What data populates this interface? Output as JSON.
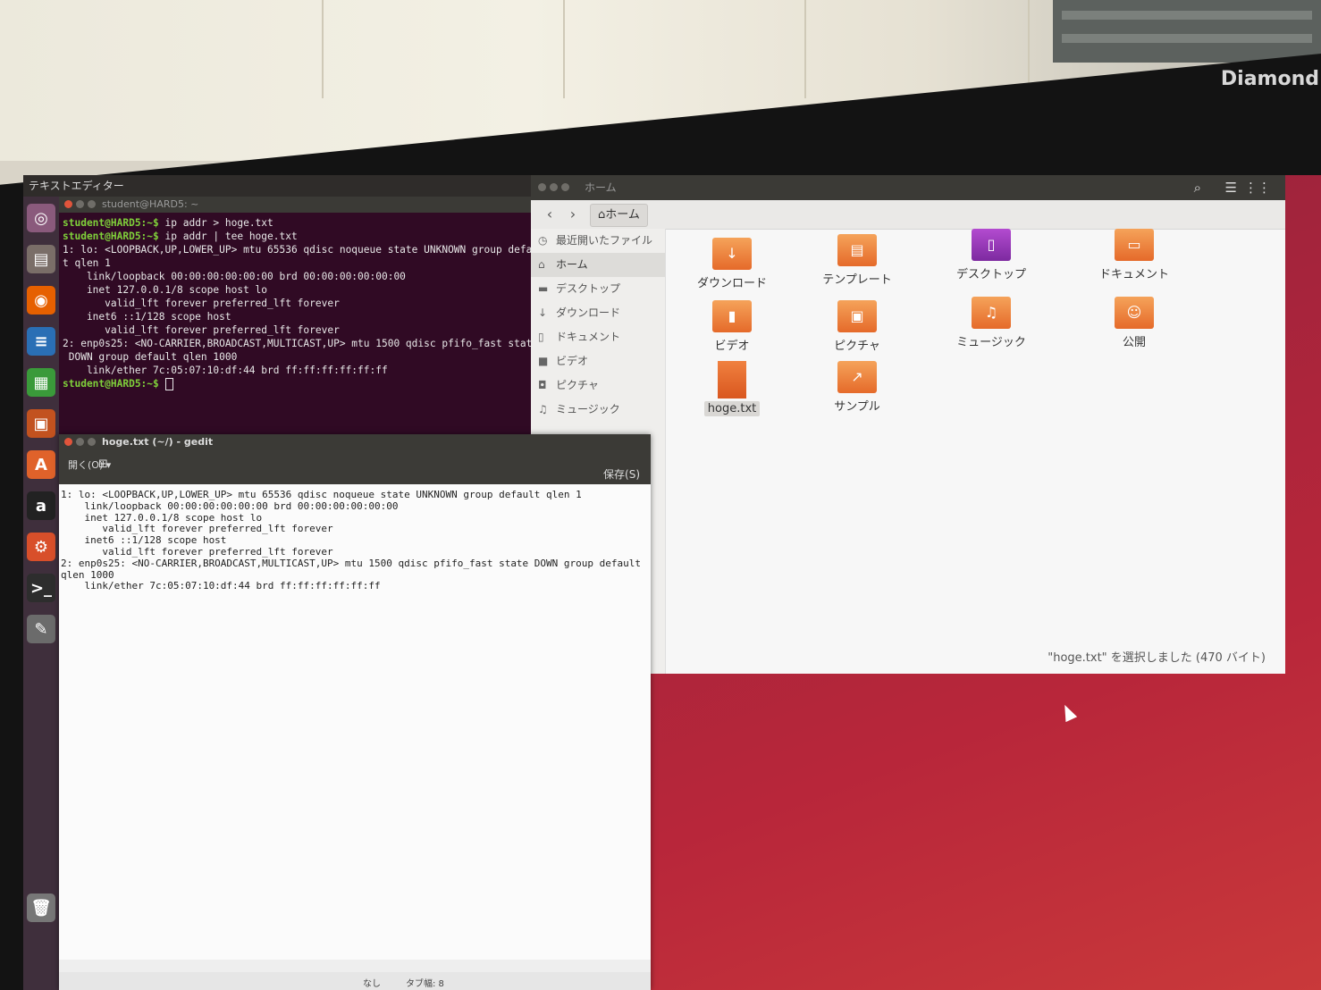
{
  "brand": "Diamond",
  "topbar": {
    "app_title": "テキストエディター"
  },
  "launcher": {
    "items": [
      {
        "name": "ubuntu-home-icon",
        "glyph": "◎"
      },
      {
        "name": "files-icon",
        "glyph": "▤"
      },
      {
        "name": "firefox-icon",
        "glyph": "◉"
      },
      {
        "name": "writer-icon",
        "glyph": "≡"
      },
      {
        "name": "calc-icon",
        "glyph": "▦"
      },
      {
        "name": "impress-icon",
        "glyph": "▣"
      },
      {
        "name": "software-center-icon",
        "glyph": "A"
      },
      {
        "name": "amazon-icon",
        "glyph": "a"
      },
      {
        "name": "settings-icon",
        "glyph": "⚙"
      },
      {
        "name": "terminal-icon",
        "glyph": ">_"
      },
      {
        "name": "text-editor-icon",
        "glyph": "✎"
      },
      {
        "name": "trash-icon",
        "glyph": "🗑"
      }
    ]
  },
  "terminal": {
    "title": "student@HARD5: ~",
    "prompt": "student@HARD5:~$",
    "lines": [
      {
        "prompt": "student@HARD5:~$",
        "text": " ip addr > hoge.txt"
      },
      {
        "prompt": "student@HARD5:~$",
        "text": " ip addr | tee hoge.txt"
      },
      {
        "prompt": "",
        "text": "1: lo: <LOOPBACK,UP,LOWER_UP> mtu 65536 qdisc noqueue state UNKNOWN group defaul"
      },
      {
        "prompt": "",
        "text": "t qlen 1"
      },
      {
        "prompt": "",
        "text": "    link/loopback 00:00:00:00:00:00 brd 00:00:00:00:00:00"
      },
      {
        "prompt": "",
        "text": "    inet 127.0.0.1/8 scope host lo"
      },
      {
        "prompt": "",
        "text": "       valid_lft forever preferred_lft forever"
      },
      {
        "prompt": "",
        "text": "    inet6 ::1/128 scope host"
      },
      {
        "prompt": "",
        "text": "       valid_lft forever preferred_lft forever"
      },
      {
        "prompt": "",
        "text": "2: enp0s25: <NO-CARRIER,BROADCAST,MULTICAST,UP> mtu 1500 qdisc pfifo_fast state"
      },
      {
        "prompt": "",
        "text": " DOWN group default qlen 1000"
      },
      {
        "prompt": "",
        "text": "    link/ether 7c:05:07:10:df:44 brd ff:ff:ff:ff:ff:ff"
      }
    ]
  },
  "files": {
    "title": "ホーム",
    "breadcrumb": "ホーム",
    "sidebar": [
      {
        "label": "最近開いたファイル",
        "glyph": "◷",
        "active": false
      },
      {
        "label": "ホーム",
        "glyph": "⌂",
        "active": true
      },
      {
        "label": "デスクトップ",
        "glyph": "▬",
        "active": false
      },
      {
        "label": "ダウンロード",
        "glyph": "↓",
        "active": false
      },
      {
        "label": "ドキュメント",
        "glyph": "▯",
        "active": false
      },
      {
        "label": "ビデオ",
        "glyph": "■",
        "active": false
      },
      {
        "label": "ピクチャ",
        "glyph": "◘",
        "active": false
      },
      {
        "label": "ミュージック",
        "glyph": "♫",
        "active": false
      }
    ],
    "items": [
      {
        "label": "ダウンロード",
        "kind": "folder",
        "glyph": "↓"
      },
      {
        "label": "テンプレート",
        "kind": "folder",
        "glyph": "▤"
      },
      {
        "label": "デスクトップ",
        "kind": "desktop",
        "glyph": "▯"
      },
      {
        "label": "ドキュメント",
        "kind": "folder",
        "glyph": "▭"
      },
      {
        "label": "ビデオ",
        "kind": "folder",
        "glyph": "▮"
      },
      {
        "label": "ピクチャ",
        "kind": "folder",
        "glyph": "▣"
      },
      {
        "label": "ミュージック",
        "kind": "folder",
        "glyph": "♫"
      },
      {
        "label": "公開",
        "kind": "folder",
        "glyph": "☺"
      },
      {
        "label": "hoge.txt",
        "kind": "file",
        "glyph": ""
      },
      {
        "label": "サンプル",
        "kind": "folder",
        "glyph": "↗"
      }
    ],
    "status": "\"hoge.txt\" を選択しました (470 バイト)"
  },
  "gedit": {
    "title": "hoge.txt (~/) - gedit",
    "open_label": "開く(O)",
    "save_label": "保存(S)",
    "content": "1: lo: <LOOPBACK,UP,LOWER_UP> mtu 65536 qdisc noqueue state UNKNOWN group default qlen 1\n    link/loopback 00:00:00:00:00:00 brd 00:00:00:00:00:00\n    inet 127.0.0.1/8 scope host lo\n       valid_lft forever preferred_lft forever\n    inet6 ::1/128 scope host\n       valid_lft forever preferred_lft forever\n2: enp0s25: <NO-CARRIER,BROADCAST,MULTICAST,UP> mtu 1500 qdisc pfifo_fast state DOWN group default\nqlen 1000\n    link/ether 7c:05:07:10:df:44 brd ff:ff:ff:ff:ff:ff",
    "status_lang": "なし",
    "status_tab": "タブ幅: 8"
  }
}
